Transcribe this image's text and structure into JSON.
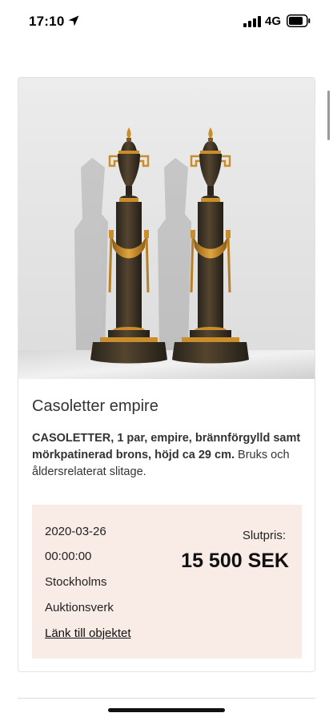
{
  "status_bar": {
    "time": "17:10",
    "network": "4G"
  },
  "item": {
    "image_alt": "Casoletter empire",
    "title": "Casoletter empire",
    "description_bold": "CASOLETTER, 1 par, empire, brännförgylld samt mörkpatinerad brons, höjd ca 29 cm.",
    "description_rest": "Bruks och åldersrelaterat slitage."
  },
  "sale": {
    "date": "2020-03-26",
    "time": "00:00:00",
    "auction_house_line1": "Stockholms",
    "auction_house_line2": "Auktionsverk",
    "link_label": "Länk till objektet",
    "price_label": "Slutpris:",
    "price": "15 500 SEK",
    "box_color": "#f9ece6"
  }
}
